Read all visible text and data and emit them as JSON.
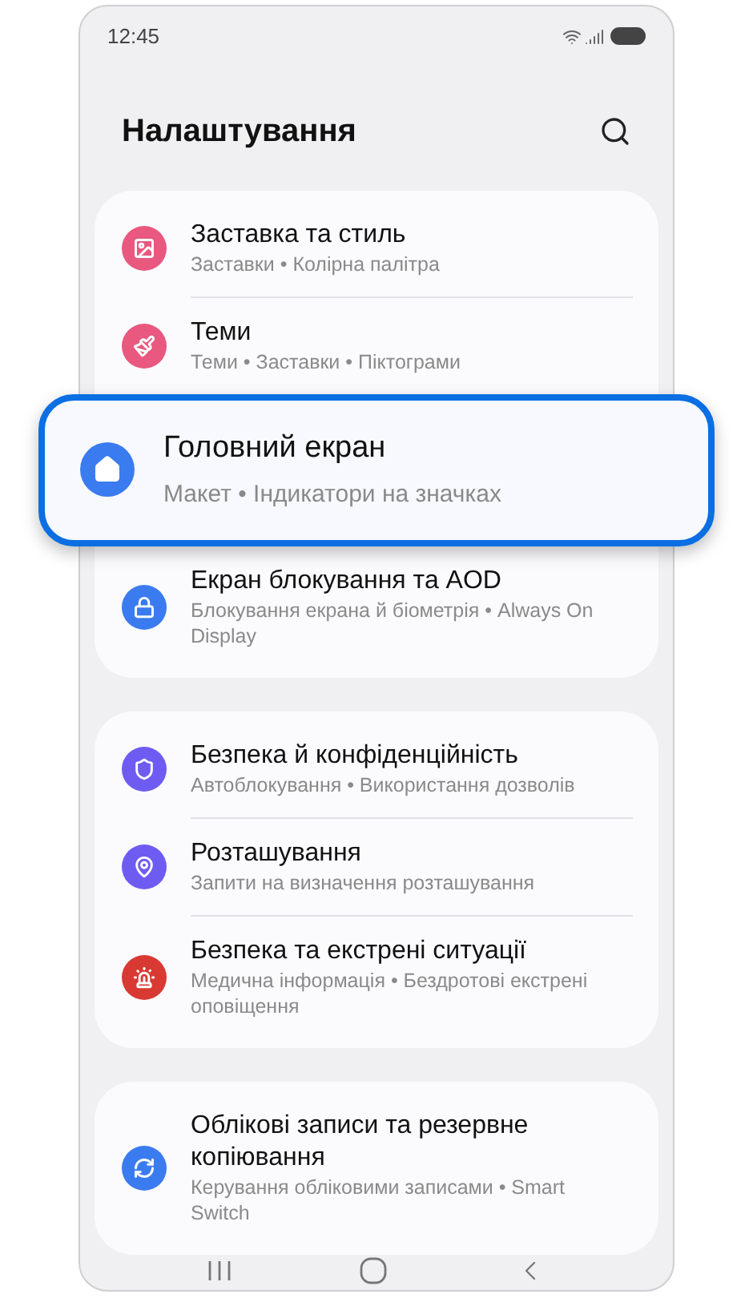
{
  "status_bar": {
    "time": "12:45"
  },
  "header": {
    "title": "Налаштування"
  },
  "groups": [
    {
      "items": [
        {
          "kind": "normal",
          "color": "#e8587f",
          "title": "Заставка та стиль",
          "subtitle": "Заставки • Колірна палітра"
        },
        {
          "kind": "normal",
          "color": "#e8587f",
          "title": "Теми",
          "subtitle": "Теми • Заставки • Піктограми"
        },
        {
          "kind": "highlighted",
          "color": "#3b7bf0",
          "title": "Головний екран",
          "subtitle": "Макет • Індикатори на значках"
        },
        {
          "kind": "normal",
          "color": "#3b7bf0",
          "title": "Екран блокування та AOD",
          "subtitle": "Блокування екрана й біометрія • Always On Display"
        }
      ]
    },
    {
      "items": [
        {
          "kind": "normal",
          "color": "#6e5cf2",
          "title": "Безпека й конфіденційність",
          "subtitle": "Автоблокування • Використання дозволів"
        },
        {
          "kind": "normal",
          "color": "#6e5cf2",
          "title": "Розташування",
          "subtitle": "Запити на визначення розташування"
        },
        {
          "kind": "normal",
          "color": "#d83a33",
          "title": "Безпека та екстрені ситуації",
          "subtitle": "Медична інформація • Бездротові екстрені оповіщення"
        }
      ]
    },
    {
      "items": [
        {
          "kind": "normal",
          "color": "#3b7bf0",
          "title": "Облікові записи та резервне копіювання",
          "subtitle": "Керування обліковими записами • Smart Switch"
        }
      ]
    }
  ]
}
